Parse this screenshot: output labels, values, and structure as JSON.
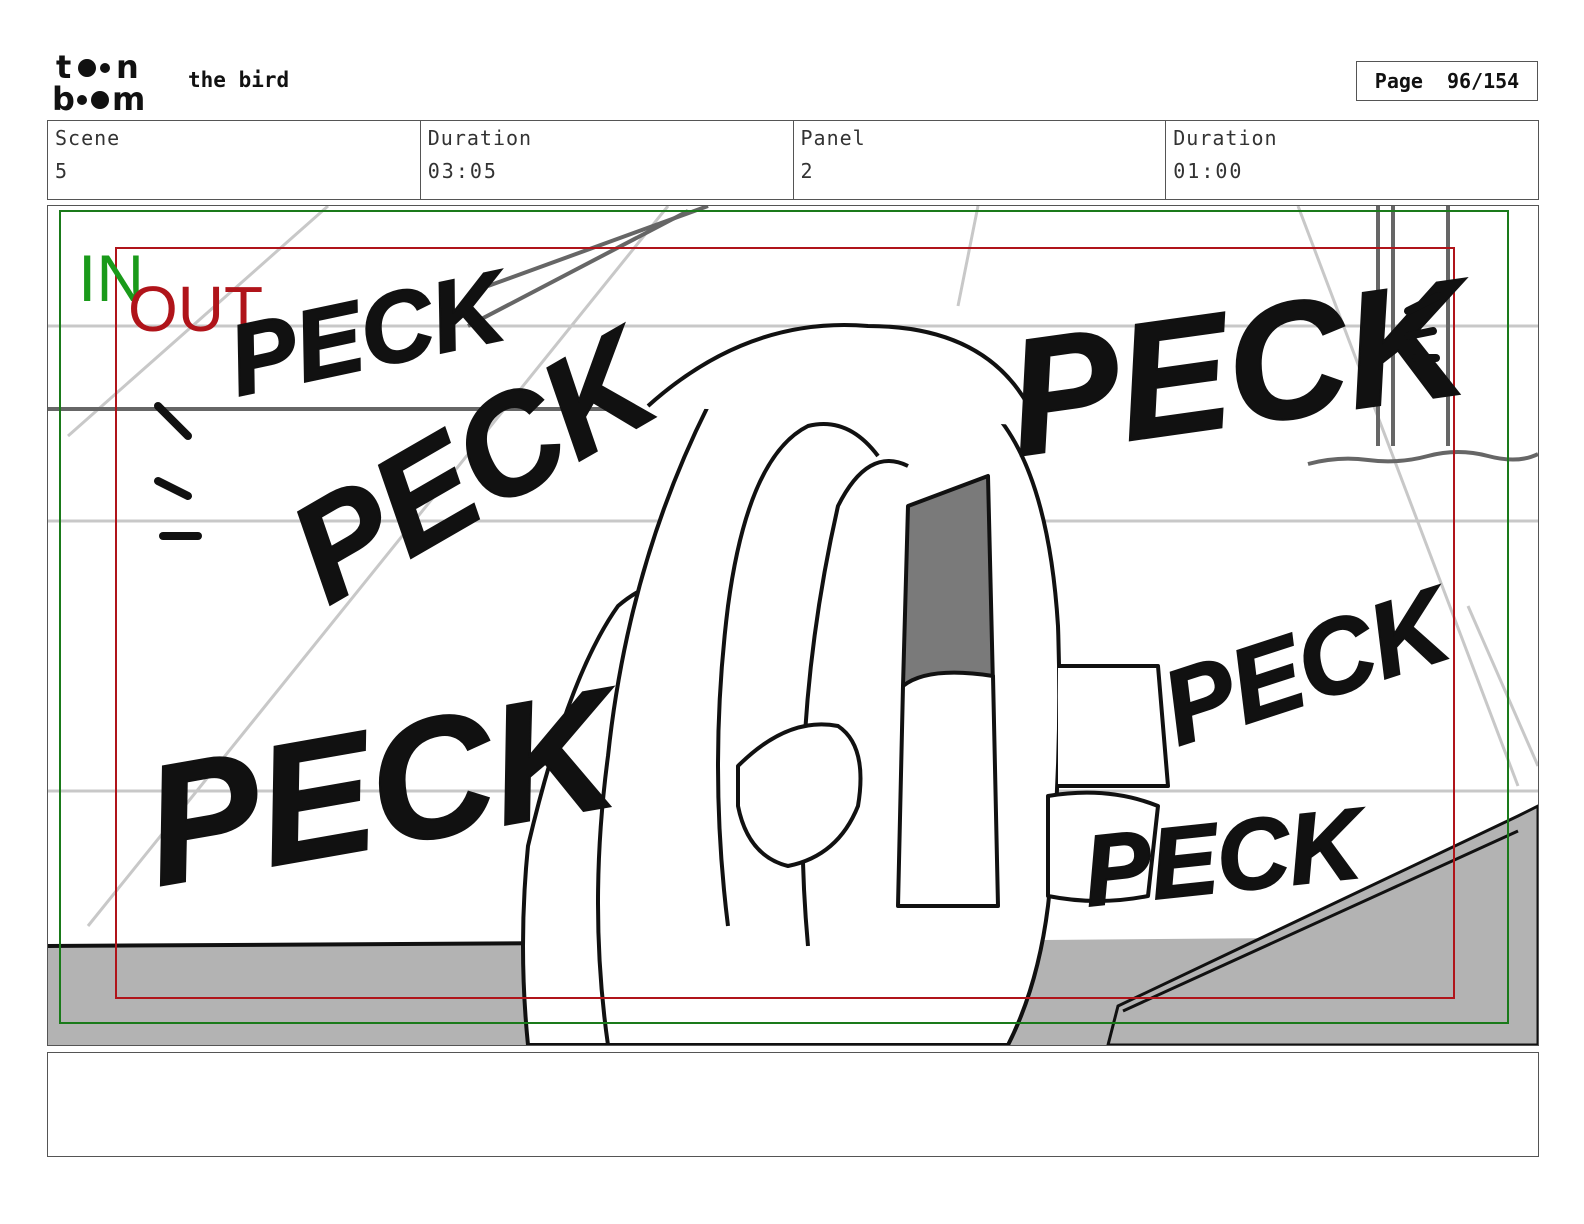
{
  "header": {
    "logo_text": "toon boom",
    "project_title": "the bird",
    "page_label": "Page",
    "page_number": "96/154"
  },
  "info": {
    "scene_label": "Scene",
    "scene_value": "5",
    "scene_duration_label": "Duration",
    "scene_duration_value": "03:05",
    "panel_label": "Panel",
    "panel_value": "2",
    "panel_duration_label": "Duration",
    "panel_duration_value": "01:00"
  },
  "panel": {
    "in_marker": "IN",
    "out_marker": "OUT",
    "sfx": [
      "PECK",
      "PECK",
      "PECK",
      "PECK",
      "PECK",
      "PECK"
    ],
    "colors": {
      "in_frame": "#1a7a1a",
      "out_frame": "#b0141a",
      "ground": "#b3b3b3",
      "guides": "#c8c8c8"
    }
  },
  "caption": {
    "text": ""
  }
}
